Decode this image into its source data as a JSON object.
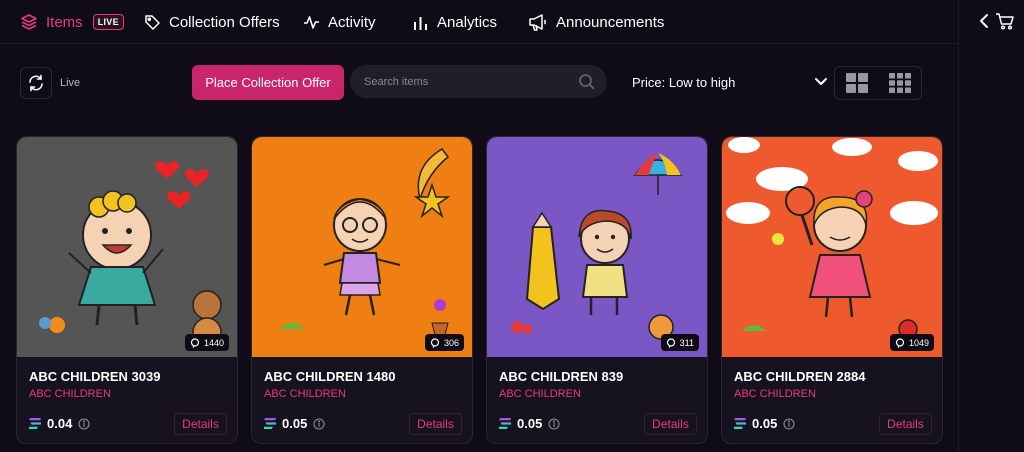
{
  "nav": {
    "items": [
      {
        "label": "Items",
        "badge": "LIVE",
        "icon": "layers-icon",
        "active": true
      },
      {
        "label": "Collection Offers",
        "icon": "tag-icon"
      },
      {
        "label": "Activity",
        "icon": "activity-icon"
      },
      {
        "label": "Analytics",
        "icon": "bar-chart-icon"
      },
      {
        "label": "Announcements",
        "icon": "megaphone-icon"
      }
    ]
  },
  "rail": {
    "icons": [
      "chevron-left-icon",
      "cart-icon"
    ]
  },
  "toolbar": {
    "refresh_label": "Live",
    "offer_button": "Place Collection Offer",
    "search_placeholder": "Search items",
    "sort_value": "Price: Low to high",
    "view_options": [
      "large-grid-icon",
      "small-grid-icon"
    ]
  },
  "cards": [
    {
      "title": "ABC CHILDREN 3039",
      "collection": "ABC CHILDREN",
      "price": "0.04",
      "views": "1440",
      "details": "Details",
      "bg": "#555555"
    },
    {
      "title": "ABC CHILDREN 1480",
      "collection": "ABC CHILDREN",
      "price": "0.05",
      "views": "306",
      "details": "Details",
      "bg": "#ef7f12"
    },
    {
      "title": "ABC CHILDREN 839",
      "collection": "ABC CHILDREN",
      "price": "0.05",
      "views": "311",
      "details": "Details",
      "bg": "#7b57c6"
    },
    {
      "title": "ABC CHILDREN 2884",
      "collection": "ABC CHILDREN",
      "price": "0.05",
      "views": "1049",
      "details": "Details",
      "bg": "#ee5a2e"
    }
  ],
  "colors": {
    "accent": "#e83a7e",
    "button": "#c8256a",
    "background": "#0f0c17"
  }
}
